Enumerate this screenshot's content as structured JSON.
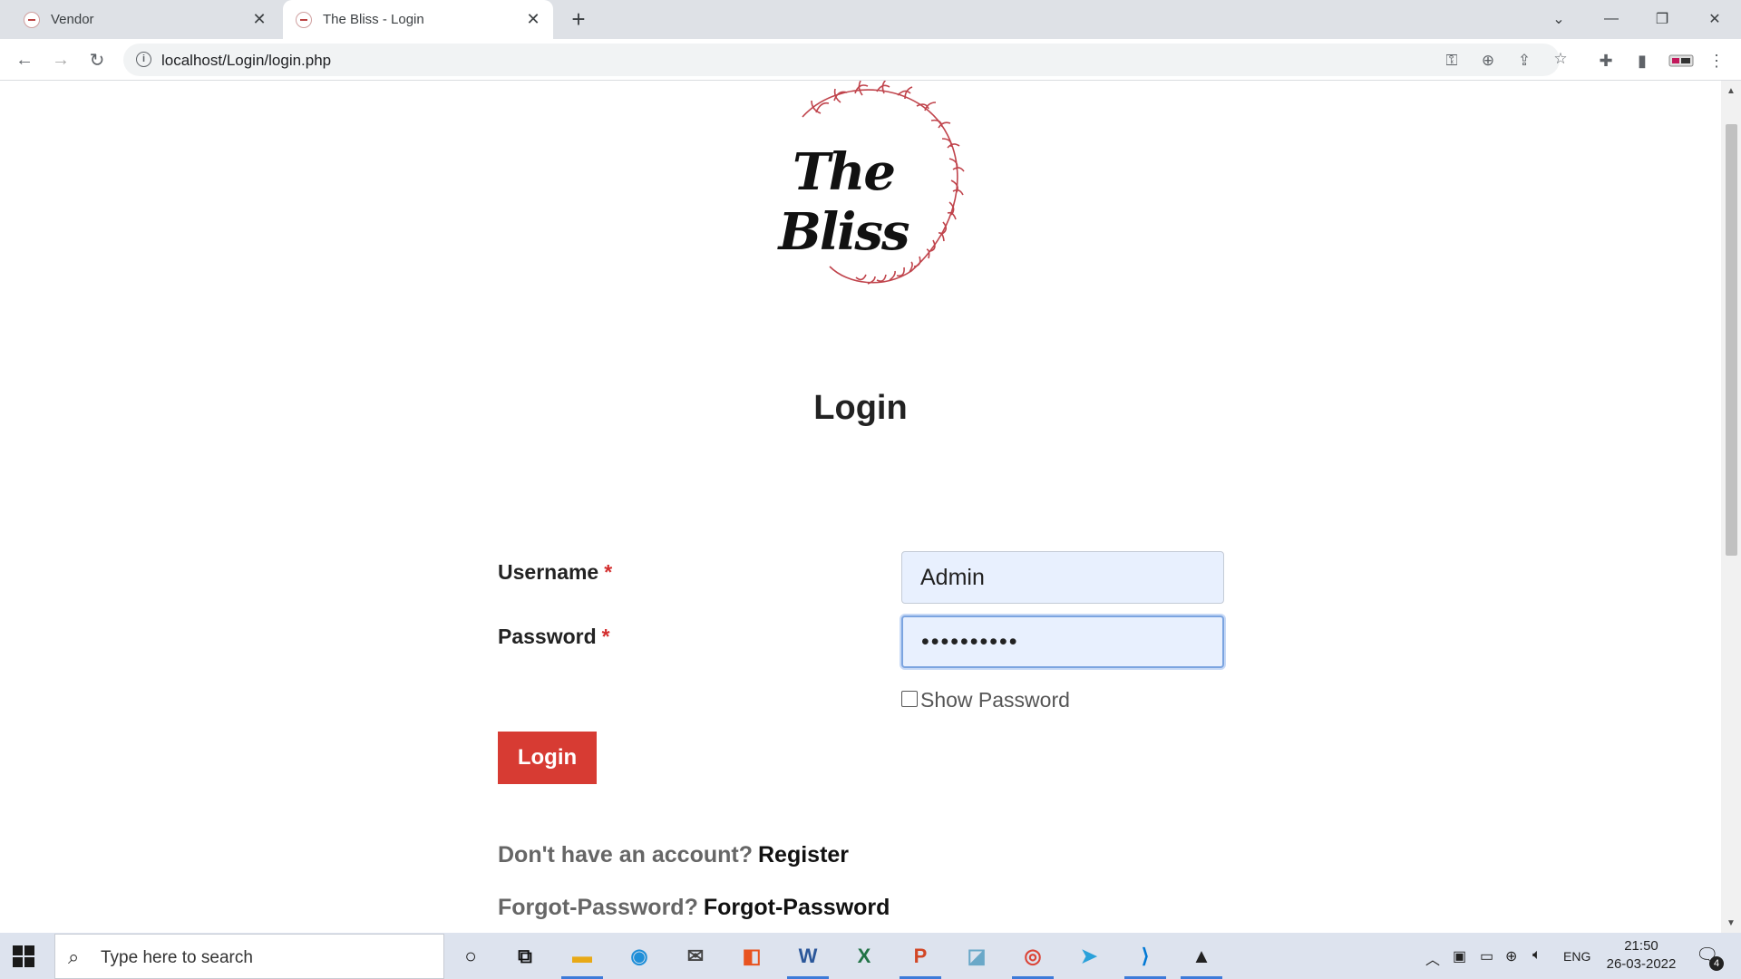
{
  "browser": {
    "tabs": [
      {
        "title": "Vendor",
        "active": false
      },
      {
        "title": "The Bliss - Login",
        "active": true
      }
    ],
    "url": "localhost/Login/login.php"
  },
  "page": {
    "logo_text": "The Bliss",
    "heading": "Login",
    "username_label": "Username",
    "password_label": "Password",
    "required_mark": "*",
    "username_value": "Admin",
    "password_value": "••••••••••",
    "show_password_label": "Show Password",
    "login_button": "Login",
    "register_prompt": "Don't have an account?",
    "register_link": "Register",
    "forgot_prompt": "Forgot-Password?",
    "forgot_link": "Forgot-Password"
  },
  "taskbar": {
    "search_placeholder": "Type here to search",
    "language": "ENG",
    "time": "21:50",
    "date": "26-03-2022",
    "notifications": "4"
  },
  "colors": {
    "accent_red": "#d73b33",
    "input_bg": "#e8f0fe"
  }
}
